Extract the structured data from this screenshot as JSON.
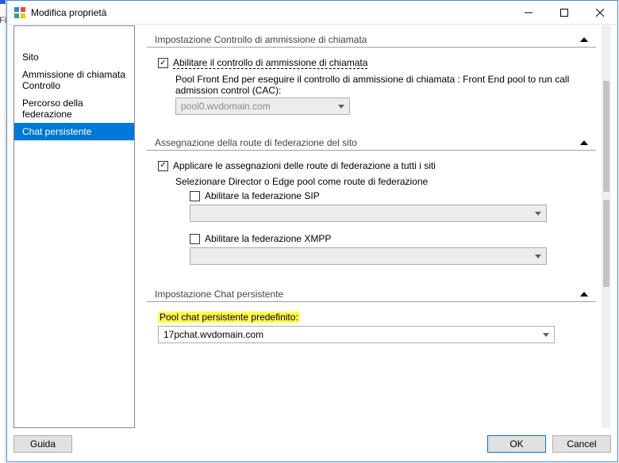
{
  "window": {
    "title": "Modifica proprietà"
  },
  "sidebar": {
    "items": [
      {
        "label": "Sito"
      },
      {
        "label": "Ammissione di chiamata Controllo"
      },
      {
        "label": "Percorso della federazione"
      },
      {
        "label": "Chat persistente"
      }
    ],
    "selected_index": 3
  },
  "sections": {
    "cac": {
      "title": "Impostazione Controllo di ammissione di chiamata",
      "enable_label": "Abilitare il controllo di ammissione di chiamata",
      "enable_checked": true,
      "pool_label": "Pool Front End per eseguire il controllo di ammissione di chiamata : Front End pool to run call admission control (CAC):",
      "pool_value": "pool0.wvdomain.com"
    },
    "fed": {
      "title": "Assegnazione della route di federazione del sito",
      "apply_label": "Applicare le assegnazioni delle route di federazione a tutti i siti",
      "apply_checked": true,
      "select_label": "Selezionare Director o Edge pool come route di federazione",
      "sip_label": "Abilitare la federazione SIP",
      "sip_checked": false,
      "sip_value": "",
      "xmpp_label": "Abilitare la federazione XMPP",
      "xmpp_checked": false,
      "xmpp_value": ""
    },
    "pchat": {
      "title": "Impostazione Chat persistente",
      "default_pool_label": "Pool chat persistente predefinito:",
      "default_pool_value": "17pchat.wvdomain.com"
    }
  },
  "buttons": {
    "help": "Guida",
    "ok": "OK",
    "cancel": "Cancel"
  }
}
